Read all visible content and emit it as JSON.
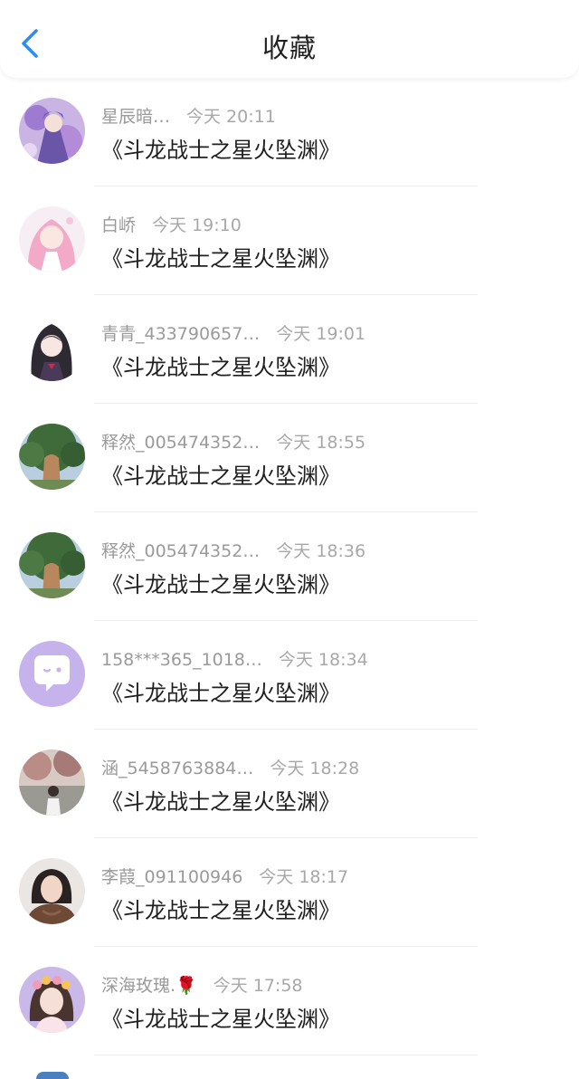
{
  "header": {
    "title": "收藏",
    "back_icon": "chevron-left-icon",
    "accent_color": "#2d8cf0"
  },
  "items": [
    {
      "user": "星辰暗…",
      "time": "今天 20:11",
      "title": "《斗龙战士之星火坠渊》",
      "avatar_icon": "anime-character-avatar"
    },
    {
      "user": "白峤",
      "time": "今天 19:10",
      "title": "《斗龙战士之星火坠渊》",
      "avatar_icon": "pink-hair-girl-avatar"
    },
    {
      "user": "青青_433790657…",
      "time": "今天 19:01",
      "title": "《斗龙战士之星火坠渊》",
      "avatar_icon": "dark-hair-anime-girl-avatar"
    },
    {
      "user": "释然_005474352…",
      "time": "今天 18:55",
      "title": "《斗龙战士之星火坠渊》",
      "avatar_icon": "tree-stone-avatar"
    },
    {
      "user": "释然_005474352…",
      "time": "今天 18:36",
      "title": "《斗龙战士之星火坠渊》",
      "avatar_icon": "tree-stone-avatar"
    },
    {
      "user": "158***365_1018…",
      "time": "今天 18:34",
      "title": "《斗龙战士之星火坠渊》",
      "avatar_icon": "default-chat-bubble-avatar"
    },
    {
      "user": "涵_5458763884…",
      "time": "今天 18:28",
      "title": "《斗龙战士之星火坠渊》",
      "avatar_icon": "outdoor-photo-avatar"
    },
    {
      "user": "李葭_091100946",
      "time": "今天 18:17",
      "title": "《斗龙战士之星火坠渊》",
      "avatar_icon": "woman-photo-avatar"
    },
    {
      "user": "深海玫瑰.🌹",
      "time": "今天 17:58",
      "title": "《斗龙战士之星火坠渊》",
      "avatar_icon": "flower-crown-girl-avatar"
    }
  ]
}
